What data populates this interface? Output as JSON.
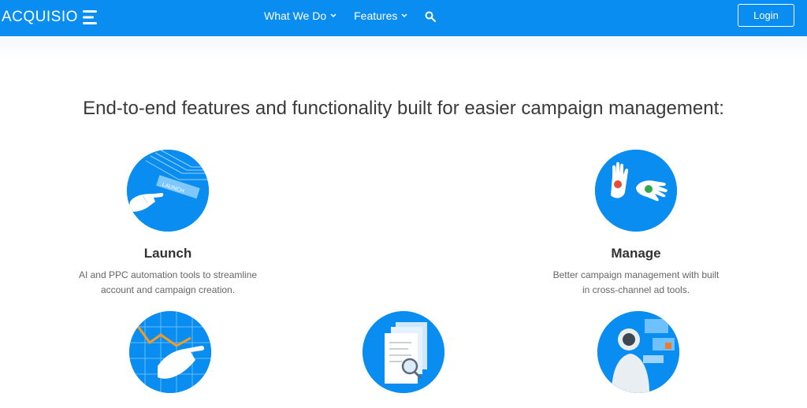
{
  "header": {
    "logo_text": "ACQUISIO",
    "nav": [
      {
        "label": "What We Do"
      },
      {
        "label": "Features"
      }
    ],
    "login_label": "Login"
  },
  "main": {
    "headline": "End-to-end features and functionality built for easier campaign management:",
    "features": [
      {
        "title": "Launch",
        "desc_line1": "AI and PPC automation tools to streamline",
        "desc_line2": "account and campaign creation.",
        "icon_text": "LAUNCH"
      },
      {
        "title": "Manage",
        "desc_line1": "Better campaign management with built",
        "desc_line2": "in cross-channel ad tools."
      }
    ]
  },
  "colors": {
    "brand_blue": "#0a8df0",
    "header_bg": "#0a8df0",
    "text_dark": "#3a3a3a",
    "text_muted": "#666666"
  }
}
